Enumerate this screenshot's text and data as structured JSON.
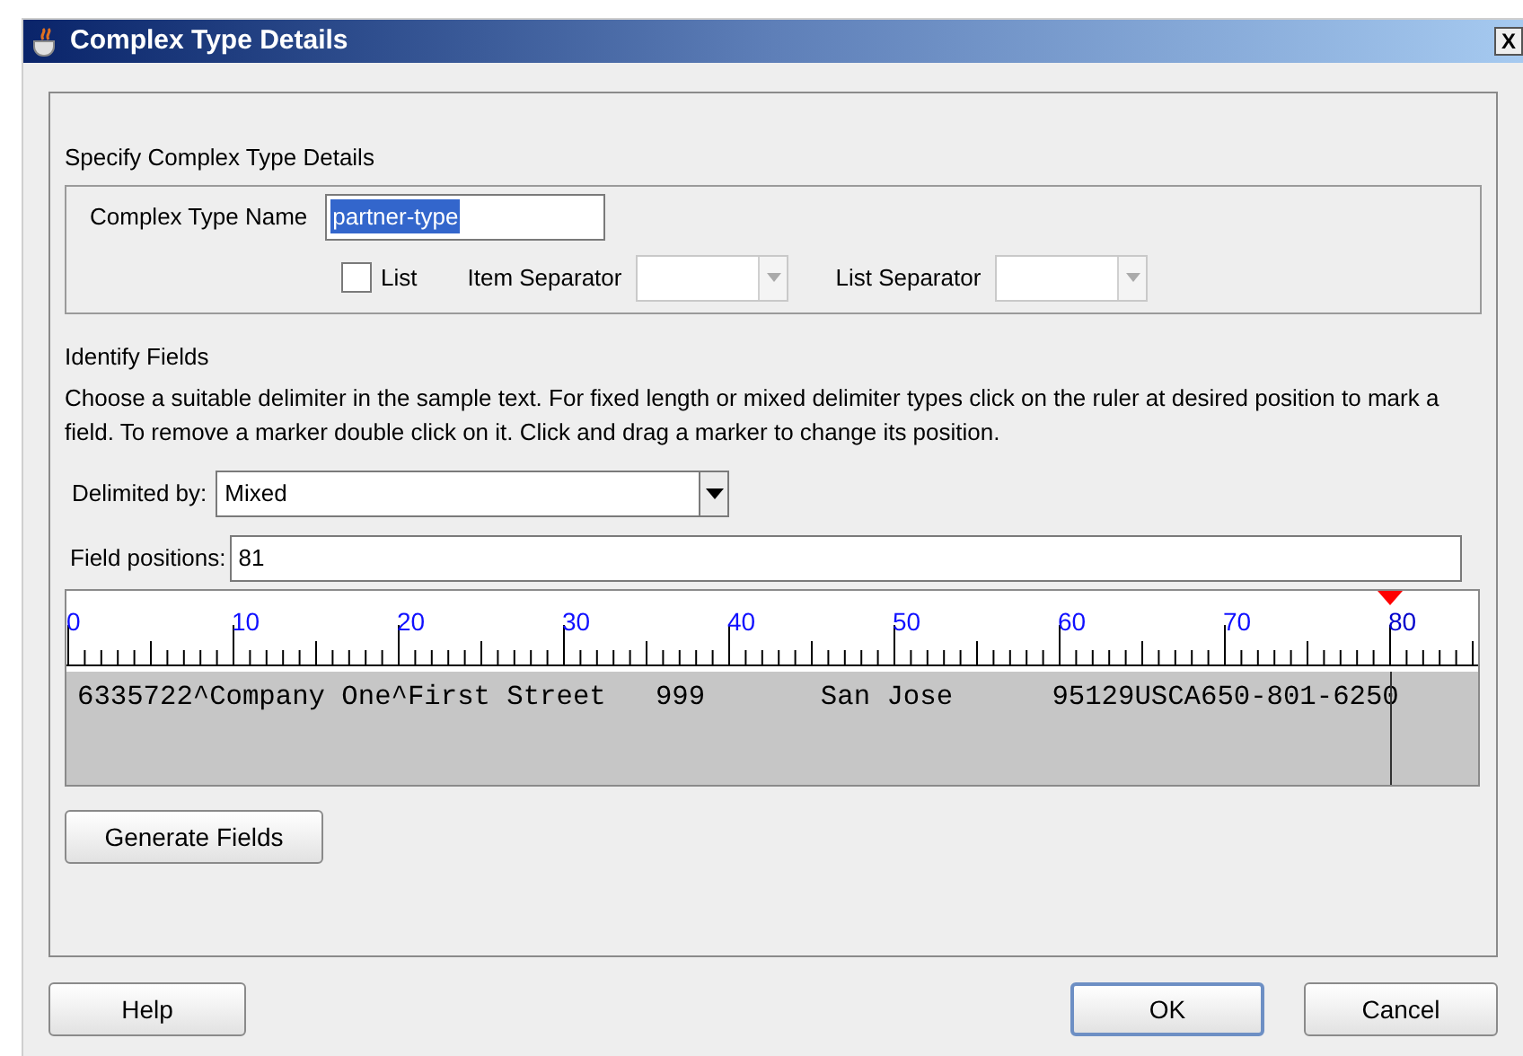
{
  "window": {
    "title": "Complex Type Details",
    "close": "X"
  },
  "section_title": "Specify Complex Type Details",
  "type_name": {
    "label": "Complex Type Name",
    "value": "partner-type",
    "selected_text": true
  },
  "list": {
    "label": "List",
    "checked": false
  },
  "item_separator": {
    "label": "Item Separator",
    "disabled": true
  },
  "list_separator": {
    "label": "List Separator",
    "disabled": true
  },
  "identify": {
    "title": "Identify Fields",
    "description": "Choose a suitable delimiter in the sample text. For fixed length or mixed delimiter types click on the ruler at desired position to mark a field. To remove a marker double click on it. Click and drag a marker to change its position."
  },
  "delimited_by": {
    "label": "Delimited by:",
    "value": "Mixed"
  },
  "field_positions": {
    "label": "Field positions:",
    "value": "81"
  },
  "ruler": {
    "labels": [
      {
        "text": "0",
        "marked": false
      },
      {
        "text": "10",
        "marked": false
      },
      {
        "text": "20",
        "marked": false
      },
      {
        "text": "30",
        "marked": false
      },
      {
        "text": "40",
        "marked": false
      },
      {
        "text": "50",
        "marked": false
      },
      {
        "text": "60",
        "marked": false
      },
      {
        "text": "70",
        "marked": false
      },
      {
        "text": "80",
        "marked": true
      }
    ],
    "sample": "6335722^Company One^First Street   999       San Jose      95129USCA650-801-6250"
  },
  "generate_button": "Generate Fields",
  "buttons": [
    {
      "label": "Help",
      "kind": "help",
      "default": false
    },
    {
      "label": "OK",
      "kind": "ok",
      "default": true
    },
    {
      "label": "Cancel",
      "kind": "cancel",
      "default": false
    }
  ]
}
